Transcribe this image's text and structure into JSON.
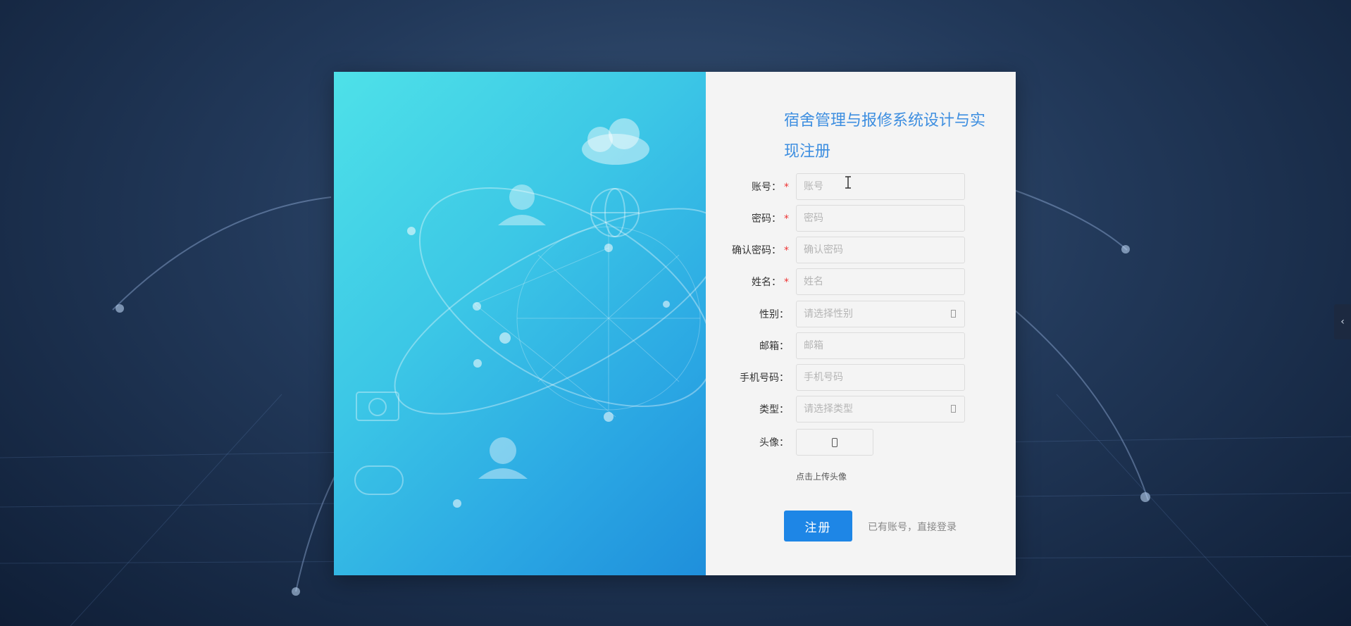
{
  "side_tab": {
    "icon": "chevron-left-icon",
    "glyph": "‹"
  },
  "register": {
    "title": "宿舍管理与报修系统设计与实现注册",
    "fields": [
      {
        "label": "账号：",
        "required": true,
        "placeholder": "账号",
        "type": "text"
      },
      {
        "label": "密码：",
        "required": true,
        "placeholder": "密码",
        "type": "password"
      },
      {
        "label": "确认密码：",
        "required": true,
        "placeholder": "确认密码",
        "type": "password"
      },
      {
        "label": "姓名：",
        "required": true,
        "placeholder": "姓名",
        "type": "text"
      },
      {
        "label": "性别：",
        "required": false,
        "placeholder": "请选择性别",
        "type": "select"
      },
      {
        "label": "邮箱：",
        "required": false,
        "placeholder": "邮箱",
        "type": "text"
      },
      {
        "label": "手机号码：",
        "required": false,
        "placeholder": "手机号码",
        "type": "text"
      },
      {
        "label": "类型：",
        "required": false,
        "placeholder": "请选择类型",
        "type": "select"
      },
      {
        "label": "头像：",
        "required": false,
        "placeholder": "",
        "type": "upload"
      }
    ],
    "required_mark": "*",
    "upload_hint": "点击上传头像",
    "submit_label": "注册",
    "login_link": "已有账号，直接登录"
  },
  "colors": {
    "accent": "#1e86e6",
    "title": "#3d8ee0",
    "required": "#ee3333",
    "panel": "#f4f4f4"
  }
}
